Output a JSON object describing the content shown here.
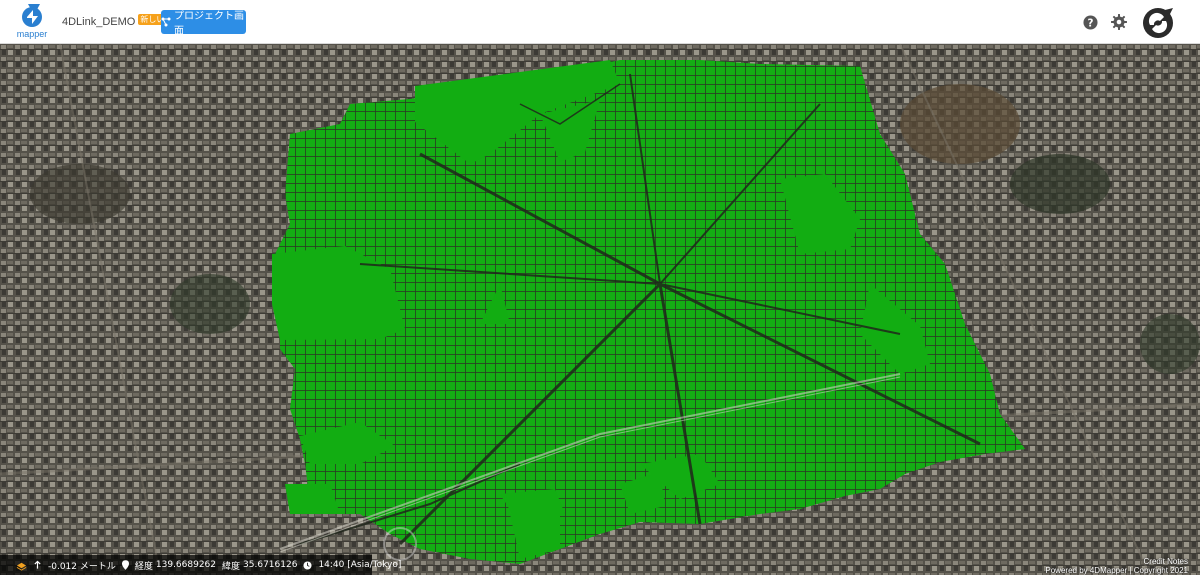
{
  "header": {
    "logo_text": "mapper",
    "project_name": "4DLink_DEMO",
    "project_badge": "新しい",
    "project_button_label": "プロジェクト画面"
  },
  "colors": {
    "overlay_green": "#12ad12",
    "accent_blue": "#2d8ee6",
    "badge_orange": "#f6a11a"
  },
  "statusbar": {
    "elevation": "-0.012 メートル",
    "longitude_label": "経度",
    "longitude": "139.6689262",
    "latitude_label": "緯度",
    "latitude": "35.6716126",
    "time": "14:40 [Asia/Tokyo]"
  },
  "credit": {
    "notes": "Credit Notes",
    "powered": "Powered by 4DMapper | Copyright 2021"
  },
  "icons": [
    "mapper-logo-icon",
    "chevron-down-icon",
    "project-icon",
    "help-icon",
    "gear-icon",
    "user-avatar-icon",
    "layers-icon",
    "up-arrow-icon",
    "location-pin-icon",
    "clock-icon"
  ]
}
